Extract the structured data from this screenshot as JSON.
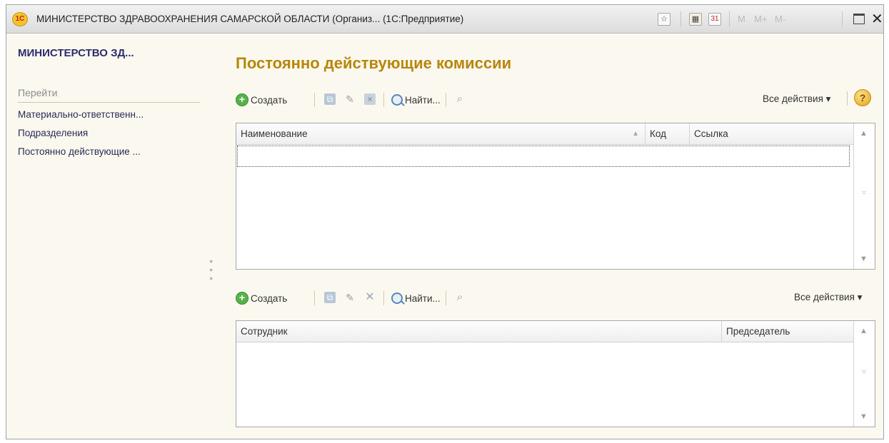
{
  "window": {
    "logo_text": "1С",
    "title": "МИНИСТЕРСТВО ЗДРАВООХРАНЕНИЯ САМАРСКОЙ ОБЛАСТИ (Организ...  (1С:Предприятие)",
    "icons": [
      "favorites-icon",
      "calculator-icon",
      "calendar-icon"
    ],
    "calendar_day": "31",
    "memory_buttons": [
      "M",
      "M+",
      "M-"
    ]
  },
  "sidebar": {
    "title": "МИНИСТЕРСТВО ЗД...",
    "goto_label": "Перейти",
    "links": [
      {
        "label": "Материально-ответственн..."
      },
      {
        "label": "Подразделения"
      },
      {
        "label": "Постоянно действующие ..."
      }
    ]
  },
  "main": {
    "title": "Постоянно действующие комиссии",
    "toolbar1": {
      "create_label": "Создать",
      "find_label": "Найти...",
      "all_actions_label": "Все действия ▾",
      "help_label": "?"
    },
    "table1": {
      "columns": [
        "Наименование",
        "Код",
        "Ссылка"
      ],
      "rows": []
    },
    "toolbar2": {
      "create_label": "Создать",
      "find_label": "Найти...",
      "all_actions_label": "Все действия ▾"
    },
    "table2": {
      "columns": [
        "Сотрудник",
        "Председатель"
      ],
      "rows": []
    }
  },
  "colors": {
    "title_accent": "#b8860b",
    "sidebar_title": "#2c2c6c",
    "background": "#fbf9ef",
    "create_icon": "#58b24a"
  }
}
